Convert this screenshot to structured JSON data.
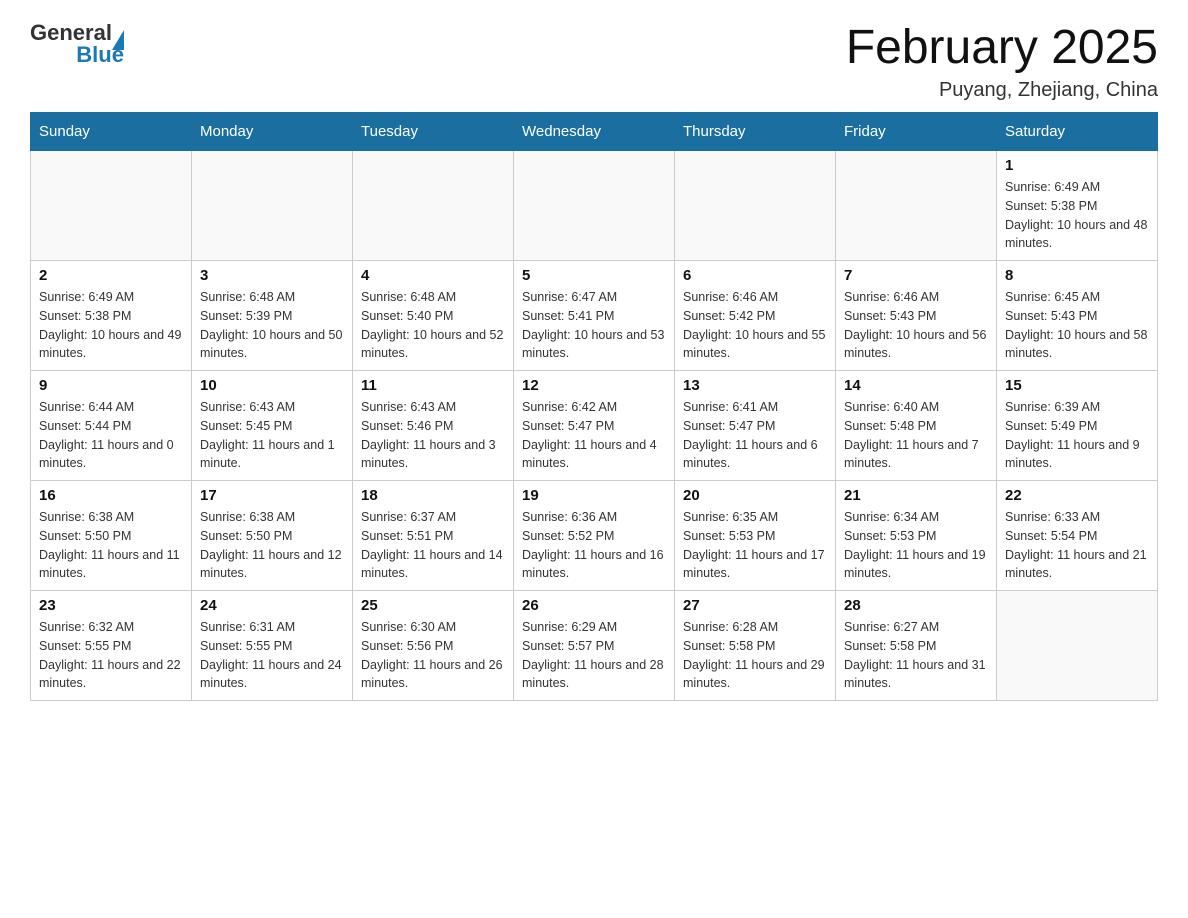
{
  "header": {
    "logo": {
      "general": "General",
      "blue": "Blue"
    },
    "title": "February 2025",
    "location": "Puyang, Zhejiang, China"
  },
  "weekdays": [
    "Sunday",
    "Monday",
    "Tuesday",
    "Wednesday",
    "Thursday",
    "Friday",
    "Saturday"
  ],
  "weeks": [
    [
      null,
      null,
      null,
      null,
      null,
      null,
      {
        "day": "1",
        "sunrise": "Sunrise: 6:49 AM",
        "sunset": "Sunset: 5:38 PM",
        "daylight": "Daylight: 10 hours and 48 minutes."
      }
    ],
    [
      {
        "day": "2",
        "sunrise": "Sunrise: 6:49 AM",
        "sunset": "Sunset: 5:38 PM",
        "daylight": "Daylight: 10 hours and 49 minutes."
      },
      {
        "day": "3",
        "sunrise": "Sunrise: 6:48 AM",
        "sunset": "Sunset: 5:39 PM",
        "daylight": "Daylight: 10 hours and 50 minutes."
      },
      {
        "day": "4",
        "sunrise": "Sunrise: 6:48 AM",
        "sunset": "Sunset: 5:40 PM",
        "daylight": "Daylight: 10 hours and 52 minutes."
      },
      {
        "day": "5",
        "sunrise": "Sunrise: 6:47 AM",
        "sunset": "Sunset: 5:41 PM",
        "daylight": "Daylight: 10 hours and 53 minutes."
      },
      {
        "day": "6",
        "sunrise": "Sunrise: 6:46 AM",
        "sunset": "Sunset: 5:42 PM",
        "daylight": "Daylight: 10 hours and 55 minutes."
      },
      {
        "day": "7",
        "sunrise": "Sunrise: 6:46 AM",
        "sunset": "Sunset: 5:43 PM",
        "daylight": "Daylight: 10 hours and 56 minutes."
      },
      {
        "day": "8",
        "sunrise": "Sunrise: 6:45 AM",
        "sunset": "Sunset: 5:43 PM",
        "daylight": "Daylight: 10 hours and 58 minutes."
      }
    ],
    [
      {
        "day": "9",
        "sunrise": "Sunrise: 6:44 AM",
        "sunset": "Sunset: 5:44 PM",
        "daylight": "Daylight: 11 hours and 0 minutes."
      },
      {
        "day": "10",
        "sunrise": "Sunrise: 6:43 AM",
        "sunset": "Sunset: 5:45 PM",
        "daylight": "Daylight: 11 hours and 1 minute."
      },
      {
        "day": "11",
        "sunrise": "Sunrise: 6:43 AM",
        "sunset": "Sunset: 5:46 PM",
        "daylight": "Daylight: 11 hours and 3 minutes."
      },
      {
        "day": "12",
        "sunrise": "Sunrise: 6:42 AM",
        "sunset": "Sunset: 5:47 PM",
        "daylight": "Daylight: 11 hours and 4 minutes."
      },
      {
        "day": "13",
        "sunrise": "Sunrise: 6:41 AM",
        "sunset": "Sunset: 5:47 PM",
        "daylight": "Daylight: 11 hours and 6 minutes."
      },
      {
        "day": "14",
        "sunrise": "Sunrise: 6:40 AM",
        "sunset": "Sunset: 5:48 PM",
        "daylight": "Daylight: 11 hours and 7 minutes."
      },
      {
        "day": "15",
        "sunrise": "Sunrise: 6:39 AM",
        "sunset": "Sunset: 5:49 PM",
        "daylight": "Daylight: 11 hours and 9 minutes."
      }
    ],
    [
      {
        "day": "16",
        "sunrise": "Sunrise: 6:38 AM",
        "sunset": "Sunset: 5:50 PM",
        "daylight": "Daylight: 11 hours and 11 minutes."
      },
      {
        "day": "17",
        "sunrise": "Sunrise: 6:38 AM",
        "sunset": "Sunset: 5:50 PM",
        "daylight": "Daylight: 11 hours and 12 minutes."
      },
      {
        "day": "18",
        "sunrise": "Sunrise: 6:37 AM",
        "sunset": "Sunset: 5:51 PM",
        "daylight": "Daylight: 11 hours and 14 minutes."
      },
      {
        "day": "19",
        "sunrise": "Sunrise: 6:36 AM",
        "sunset": "Sunset: 5:52 PM",
        "daylight": "Daylight: 11 hours and 16 minutes."
      },
      {
        "day": "20",
        "sunrise": "Sunrise: 6:35 AM",
        "sunset": "Sunset: 5:53 PM",
        "daylight": "Daylight: 11 hours and 17 minutes."
      },
      {
        "day": "21",
        "sunrise": "Sunrise: 6:34 AM",
        "sunset": "Sunset: 5:53 PM",
        "daylight": "Daylight: 11 hours and 19 minutes."
      },
      {
        "day": "22",
        "sunrise": "Sunrise: 6:33 AM",
        "sunset": "Sunset: 5:54 PM",
        "daylight": "Daylight: 11 hours and 21 minutes."
      }
    ],
    [
      {
        "day": "23",
        "sunrise": "Sunrise: 6:32 AM",
        "sunset": "Sunset: 5:55 PM",
        "daylight": "Daylight: 11 hours and 22 minutes."
      },
      {
        "day": "24",
        "sunrise": "Sunrise: 6:31 AM",
        "sunset": "Sunset: 5:55 PM",
        "daylight": "Daylight: 11 hours and 24 minutes."
      },
      {
        "day": "25",
        "sunrise": "Sunrise: 6:30 AM",
        "sunset": "Sunset: 5:56 PM",
        "daylight": "Daylight: 11 hours and 26 minutes."
      },
      {
        "day": "26",
        "sunrise": "Sunrise: 6:29 AM",
        "sunset": "Sunset: 5:57 PM",
        "daylight": "Daylight: 11 hours and 28 minutes."
      },
      {
        "day": "27",
        "sunrise": "Sunrise: 6:28 AM",
        "sunset": "Sunset: 5:58 PM",
        "daylight": "Daylight: 11 hours and 29 minutes."
      },
      {
        "day": "28",
        "sunrise": "Sunrise: 6:27 AM",
        "sunset": "Sunset: 5:58 PM",
        "daylight": "Daylight: 11 hours and 31 minutes."
      },
      null
    ]
  ]
}
